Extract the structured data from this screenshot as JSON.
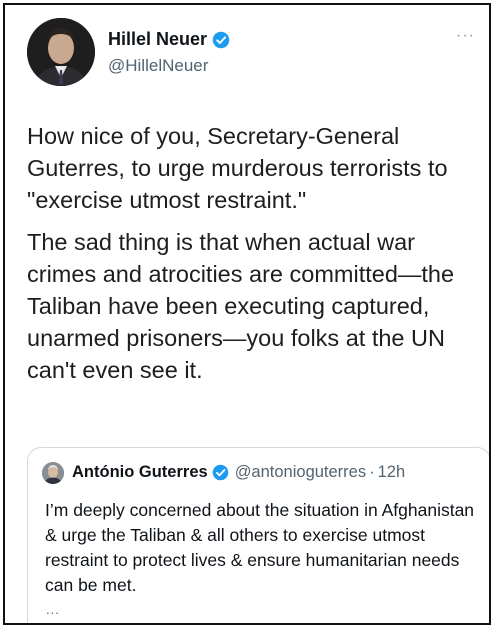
{
  "tweet": {
    "author": {
      "name": "Hillel Neuer",
      "handle": "@HillelNeuer",
      "verified": true,
      "avatar": "profile-photo"
    },
    "more_icon": "···",
    "paragraphs": [
      "How nice of you, Secretary-General Guterres, to urge murderous terrorists to \"exercise utmost restraint.\"",
      "The sad thing is that when actual war crimes and atrocities are committed—the Taliban have been executing captured, unarmed prisoners—you folks at the UN can't even see it."
    ]
  },
  "quoted_tweet": {
    "author": {
      "name": "António Guterres",
      "handle": "@antonioguterres",
      "verified": true,
      "avatar": "profile-photo"
    },
    "separator": "·",
    "time": "12h",
    "text": "I’m deeply concerned about the situation in Afghanistan & urge the Taliban & all others to exercise utmost restraint to protect lives & ensure humanitarian needs can be met.",
    "ellipsis": "..."
  },
  "colors": {
    "verified_badge": "#1d9bf0",
    "secondary_text": "#536471",
    "border": "#cfd9de"
  }
}
